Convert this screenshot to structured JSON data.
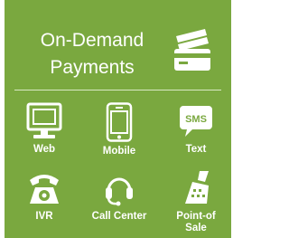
{
  "colors": {
    "panel_bg": "#7aa83f",
    "text": "#ffffff",
    "divider": "#d9e9c4"
  },
  "header": {
    "title_line1": "On-Demand",
    "title_line2": "Payments",
    "icon": "credit-cards-icon"
  },
  "channels": [
    {
      "label": "Web",
      "icon": "monitor-icon"
    },
    {
      "label": "Mobile",
      "icon": "smartphone-icon"
    },
    {
      "label": "Text",
      "icon": "sms-bubble-icon",
      "badge": "SMS"
    },
    {
      "label": "IVR",
      "icon": "telephone-icon"
    },
    {
      "label": "Call Center",
      "icon": "headset-icon"
    },
    {
      "label": "Point-of\nSale",
      "icon": "card-reader-icon"
    }
  ]
}
